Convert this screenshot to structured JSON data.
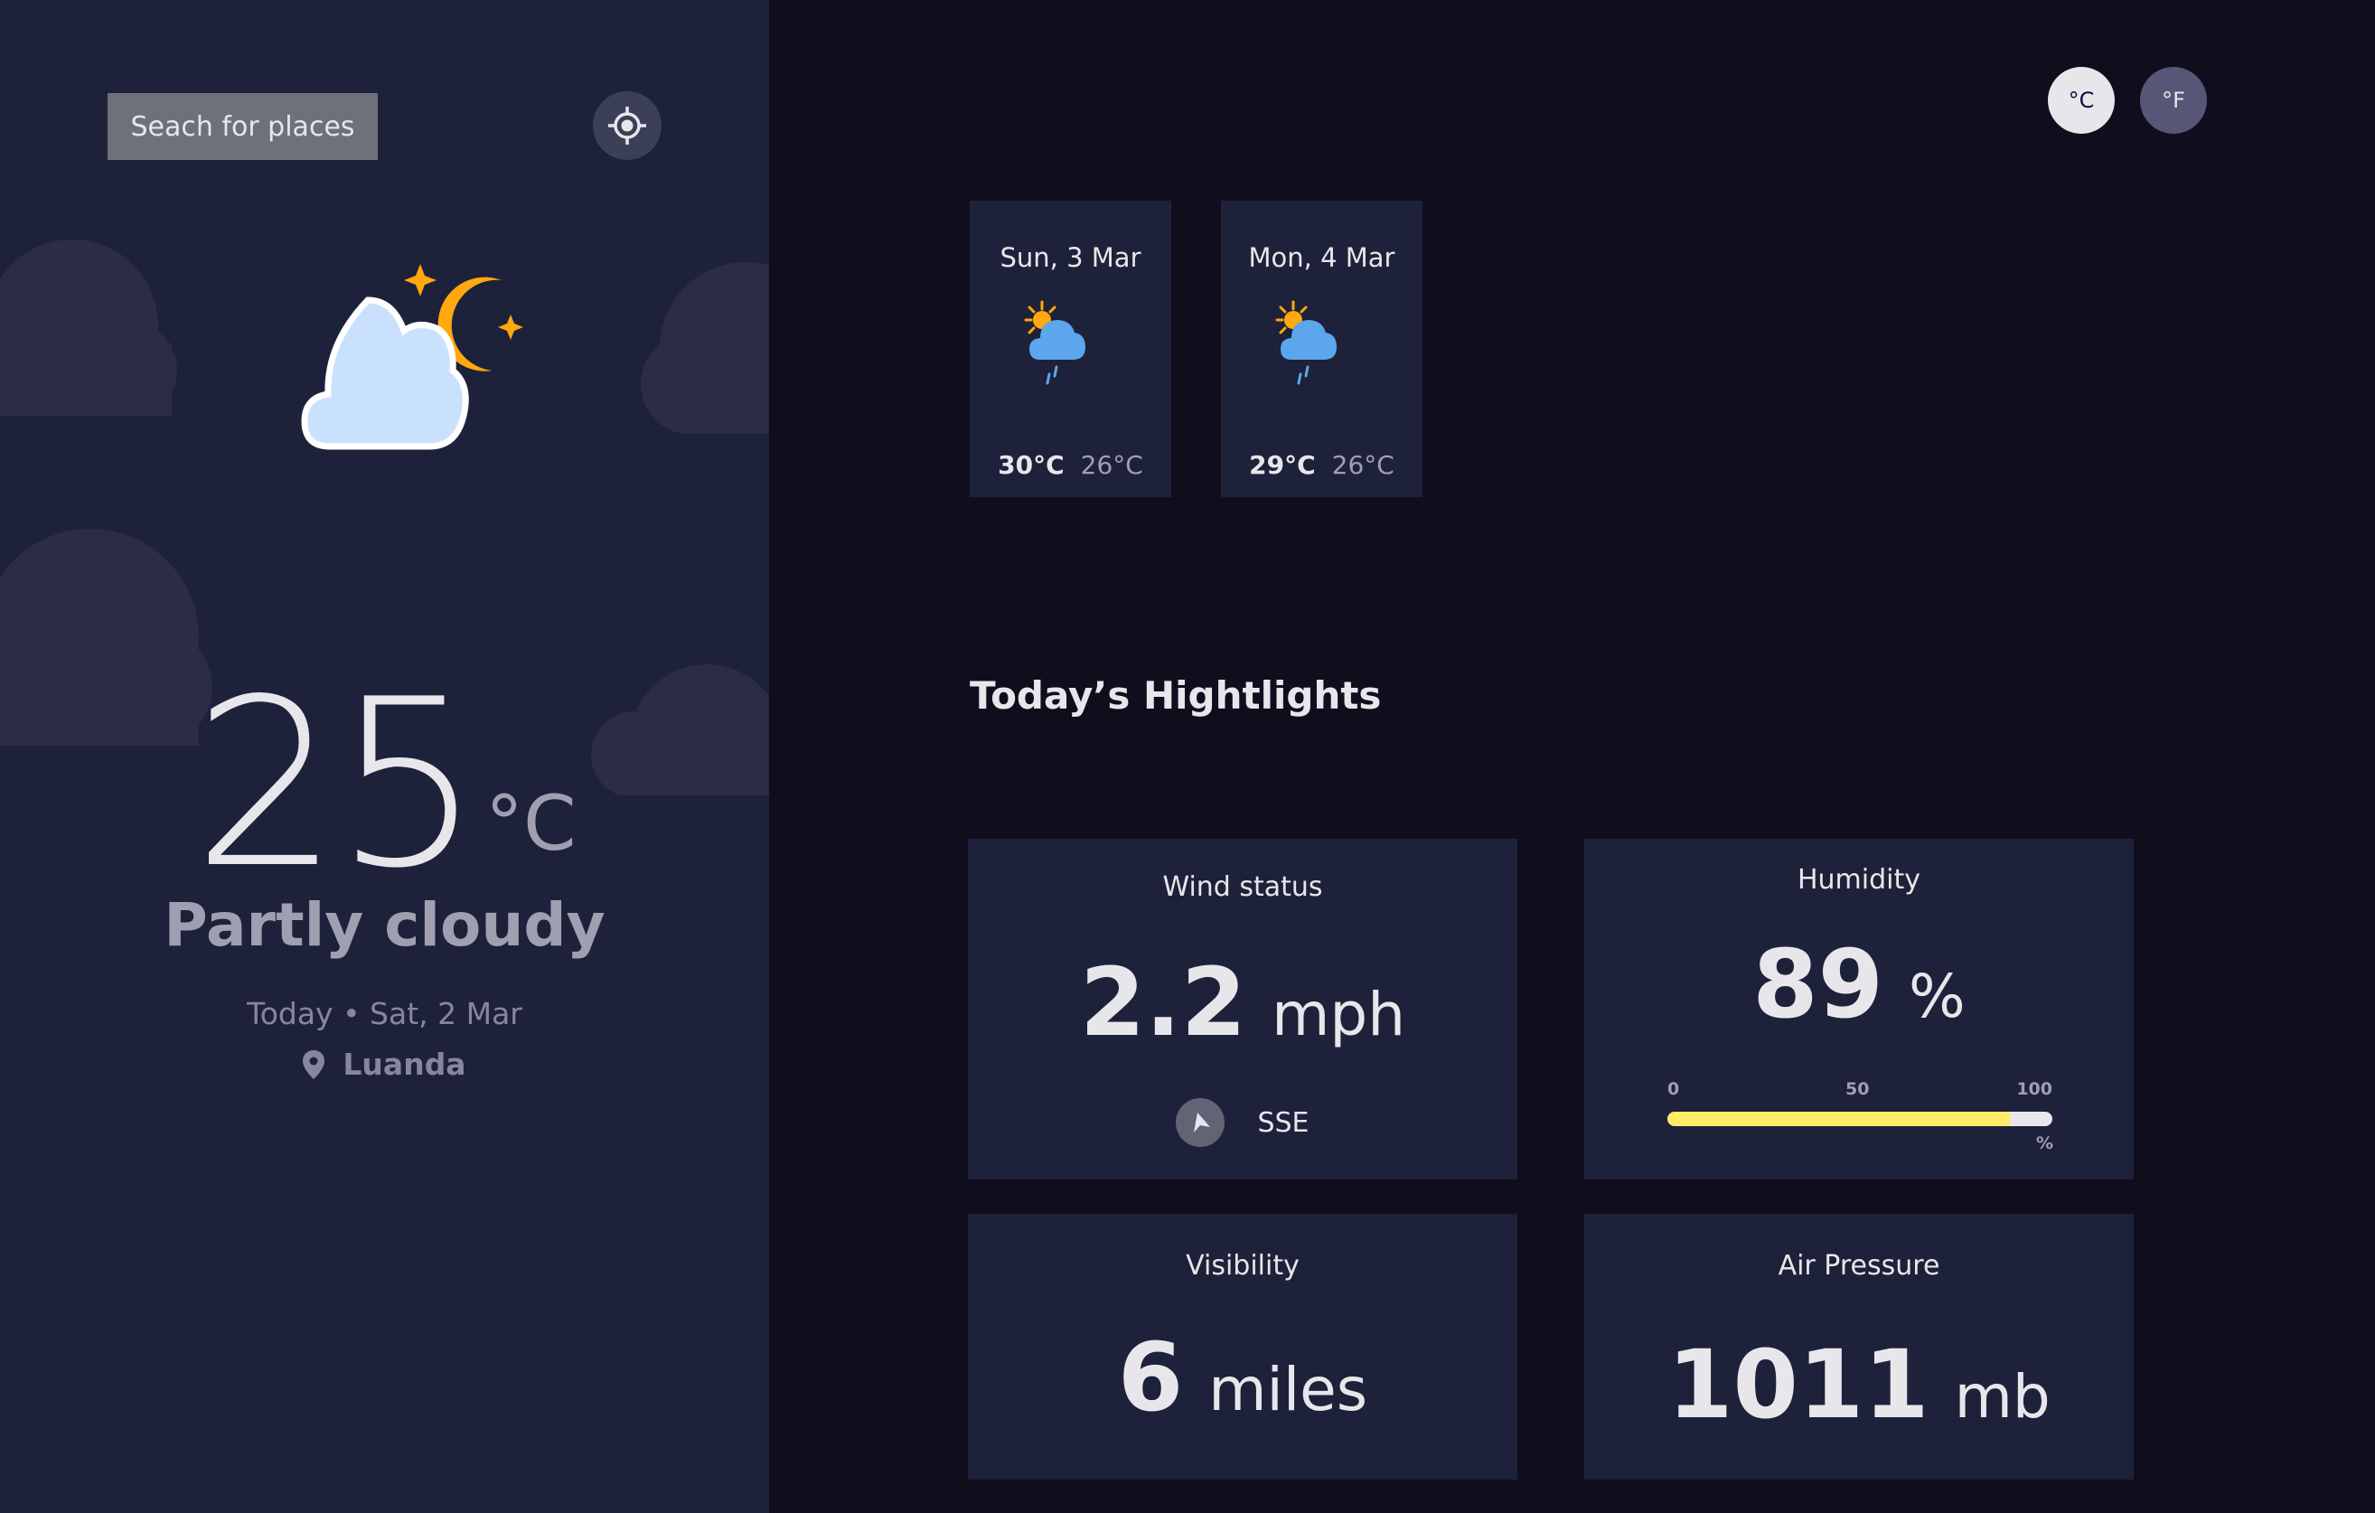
{
  "sidebar": {
    "search_label": "Seach for places",
    "current": {
      "icon": "partly-cloudy-night-icon",
      "temperature": "25",
      "unit": "°C",
      "condition": "Partly cloudy",
      "date_line": "Today • Sat, 2 Mar",
      "location": "Luanda"
    }
  },
  "units": {
    "celsius": "°C",
    "fahrenheit": "°F",
    "selected": "celsius"
  },
  "forecast": [
    {
      "date": "Sun, 3 Mar",
      "icon": "sun-rain-cloud-icon",
      "max": "30°C",
      "min": "26°C"
    },
    {
      "date": "Mon, 4 Mar",
      "icon": "sun-rain-cloud-icon",
      "max": "29°C",
      "min": "26°C"
    }
  ],
  "highlights": {
    "title": "Today’s Hightlights",
    "wind": {
      "label": "Wind status",
      "value": "2.2",
      "unit": "mph",
      "direction": "SSE"
    },
    "humidity": {
      "label": "Humidity",
      "value": "89",
      "unit": "%",
      "scale": [
        "0",
        "50",
        "100"
      ],
      "scale_unit": "%",
      "level": 89
    },
    "visibility": {
      "label": "Visibility",
      "value": "6",
      "unit": "miles"
    },
    "pressure": {
      "label": "Air Pressure",
      "value": "1011",
      "unit": "mb"
    }
  },
  "colors": {
    "sidebar_bg": "#1e213a",
    "main_bg": "#100e1d",
    "card_bg": "#1e213a",
    "humidity_bar": "#ffec65",
    "moon": "#ffa80f"
  }
}
